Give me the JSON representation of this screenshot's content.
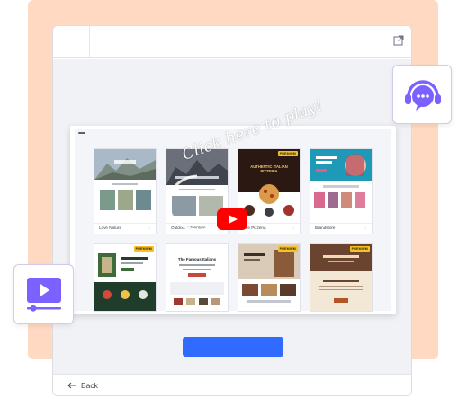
{
  "footer": {
    "back_label": "Back"
  },
  "video": {
    "overlay_text": "Click here to play!"
  },
  "templates": [
    {
      "label": "Love Nature",
      "premium": false
    },
    {
      "label": "Outdoor Adventure",
      "premium": false
    },
    {
      "label": "The Pizzeria",
      "premium": true,
      "badge": "PREMIUM",
      "headline": "AUTHENTIC ITALIAN PIZZERIA"
    },
    {
      "label": "Brandstore",
      "premium": false
    },
    {
      "label": "",
      "premium": true,
      "badge": "PREMIUM"
    },
    {
      "label": "",
      "premium": false,
      "headline": "The Famous Italians"
    },
    {
      "label": "",
      "premium": true,
      "badge": "PREMIUM"
    },
    {
      "label": "",
      "premium": true,
      "badge": "PREMIUM"
    }
  ],
  "icons": {
    "external": "external-link-icon",
    "back": "arrow-left-icon",
    "support": "headset-chat-icon",
    "video": "video-player-icon",
    "play": "youtube-play-icon",
    "favorite": "heart-icon"
  },
  "colors": {
    "accent": "#2f6bff",
    "peach": "#ffd9c2",
    "badge_purple": "#7b61ff",
    "youtube_red": "#ff0000",
    "premium_yellow": "#f6c12a"
  }
}
